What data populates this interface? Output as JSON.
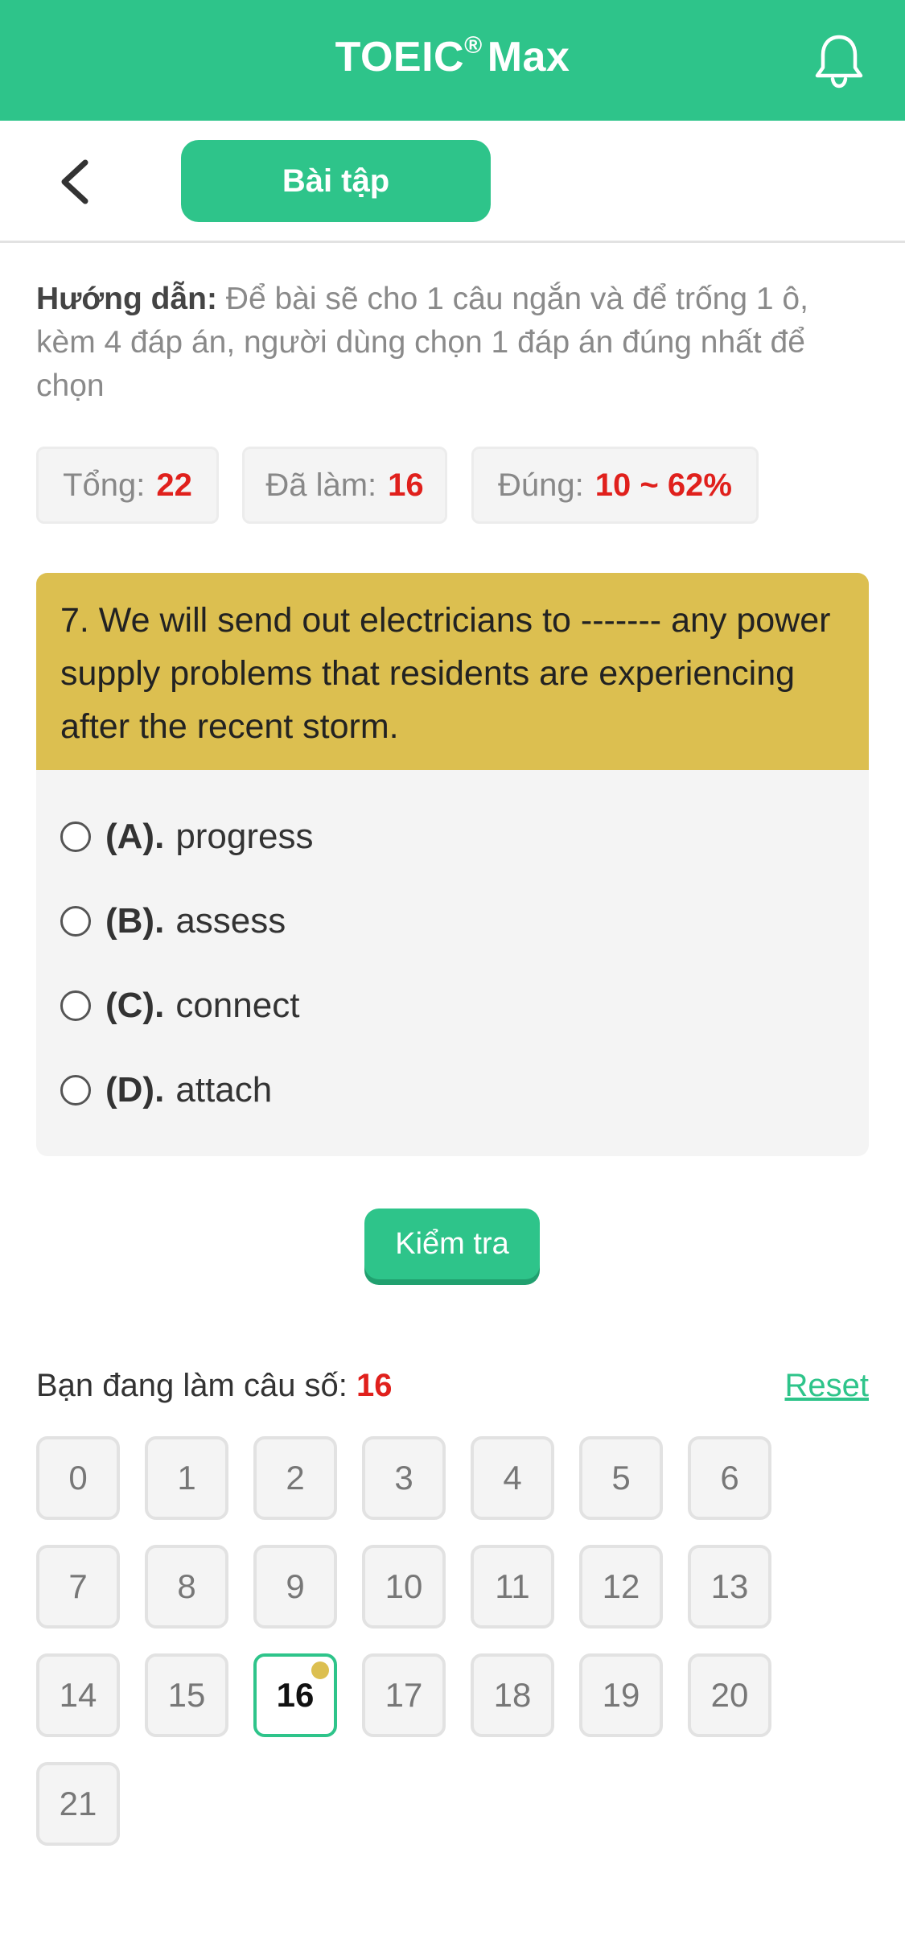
{
  "header": {
    "title": "TOEIC",
    "title_sup": "®",
    "title_suffix": "Max",
    "brand_color": "#2ec48a",
    "notification_icon": "bell-icon"
  },
  "toolbar": {
    "back_icon": "chevron-left-icon",
    "tab_label": "Bài tập"
  },
  "instructions": {
    "label": "Hướng dẫn:",
    "text": "Để bài sẽ cho 1 câu ngắn và để trống 1 ô, kèm 4 đáp án, người dùng chọn 1 đáp án đúng nhất để chọn"
  },
  "stats": {
    "total_label": "Tổng:",
    "total_value": "22",
    "done_label": "Đã làm:",
    "done_value": "16",
    "correct_label": "Đúng:",
    "correct_value": "10 ~ 62%"
  },
  "question": {
    "text": "7. We will send out electricians to ------- any power supply problems that residents are experiencing after the recent storm.",
    "card_color": "#dcbf50",
    "options": [
      {
        "letter": "(A).",
        "text": "progress"
      },
      {
        "letter": "(B).",
        "text": "assess"
      },
      {
        "letter": "(C).",
        "text": "connect"
      },
      {
        "letter": "(D).",
        "text": "attach"
      }
    ]
  },
  "check_button": {
    "label": "Kiểm tra"
  },
  "progress": {
    "label": "Bạn đang làm câu số:",
    "current": "16",
    "reset_label": "Reset"
  },
  "grid": {
    "numbers": [
      "0",
      "1",
      "2",
      "3",
      "4",
      "5",
      "6",
      "7",
      "8",
      "9",
      "10",
      "11",
      "12",
      "13",
      "14",
      "15",
      "16",
      "17",
      "18",
      "19",
      "20",
      "21"
    ],
    "active_index": 16,
    "accent_color": "#2ec48a"
  }
}
